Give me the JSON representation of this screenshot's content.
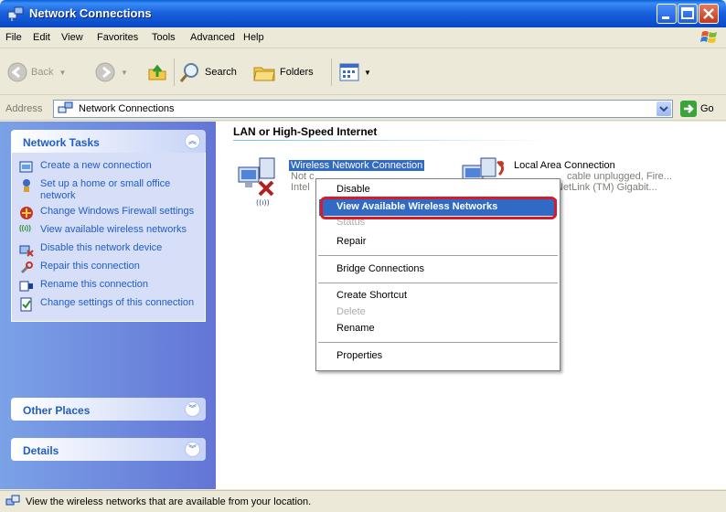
{
  "window": {
    "title": "Network Connections"
  },
  "menubar": {
    "items": [
      "File",
      "Edit",
      "View",
      "Favorites",
      "Tools",
      "Advanced",
      "Help"
    ]
  },
  "toolbar": {
    "back": "Back",
    "search": "Search",
    "folders": "Folders"
  },
  "address": {
    "label": "Address",
    "value": "Network Connections",
    "go": "Go"
  },
  "left_pane": {
    "network_tasks": {
      "title": "Network Tasks",
      "items": [
        {
          "label": "Create a new connection",
          "icon": "new-connection-icon"
        },
        {
          "label": "Set up a home or small office network",
          "icon": "home-network-icon"
        },
        {
          "label": "Change Windows Firewall settings",
          "icon": "firewall-icon"
        },
        {
          "label": "View available wireless networks",
          "icon": "wireless-icon"
        },
        {
          "label": "Disable this network device",
          "icon": "disable-device-icon"
        },
        {
          "label": "Repair this connection",
          "icon": "repair-icon"
        },
        {
          "label": "Rename this connection",
          "icon": "rename-icon"
        },
        {
          "label": "Change settings of this connection",
          "icon": "settings-icon"
        }
      ]
    },
    "other_places": {
      "title": "Other Places"
    },
    "details": {
      "title": "Details"
    }
  },
  "main": {
    "group_title": "LAN or High-Speed Internet",
    "wireless": {
      "name": "Wireless Network Connection",
      "status_fragment": "Not c",
      "device_fragment": "Intel"
    },
    "local": {
      "name": "Local Area Connection",
      "status_fragment": "cable unplugged, Fire...",
      "device_fragment": "NetLink (TM) Gigabit..."
    }
  },
  "context_menu": {
    "items": [
      "Disable",
      "View Available Wireless Networks",
      "Status",
      "Repair",
      "Bridge Connections",
      "Create Shortcut",
      "Delete",
      "Rename",
      "Properties"
    ]
  },
  "status_bar": {
    "text": "View the wireless networks that are available from your location."
  }
}
